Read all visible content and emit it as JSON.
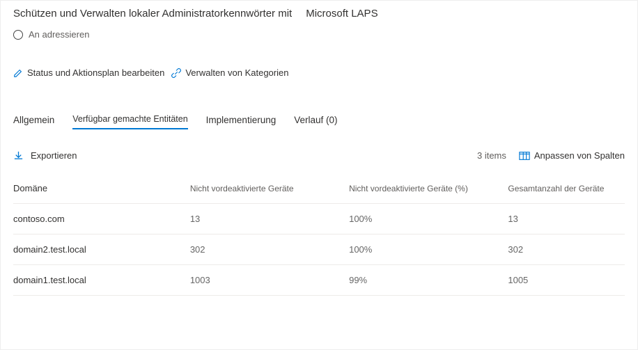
{
  "title": {
    "prefix": "Schützen und Verwalten lokaler Administratorkennwörter mit",
    "product": "Microsoft LAPS"
  },
  "address": {
    "label": "An adressieren"
  },
  "actions": {
    "edit": "Status und Aktionsplan bearbeiten",
    "categories": "Verwalten von Kategorien"
  },
  "tabs": {
    "general": "Allgemein",
    "exposed": "Verfügbar gemachte Entitäten",
    "implementation": "Implementierung",
    "history": "Verlauf (0)"
  },
  "toolbar": {
    "export": "Exportieren",
    "items": "3 items",
    "columns": "Anpassen von Spalten"
  },
  "table": {
    "headers": {
      "domain": "Domäne",
      "notActivated": "Nicht vordeaktivierte Geräte",
      "notActivatedPct": "Nicht vordeaktivierte Geräte (%)",
      "total": "Gesamtanzahl der Geräte"
    },
    "rows": [
      {
        "domain": "contoso.com",
        "notActivated": "13",
        "notActivatedPct": "100%",
        "total": "13"
      },
      {
        "domain": "domain2.test.local",
        "notActivated": "302",
        "notActivatedPct": "100%",
        "total": "302"
      },
      {
        "domain": "domain1.test.local",
        "notActivated": "1003",
        "notActivatedPct": "99%",
        "total": "1005"
      }
    ]
  }
}
